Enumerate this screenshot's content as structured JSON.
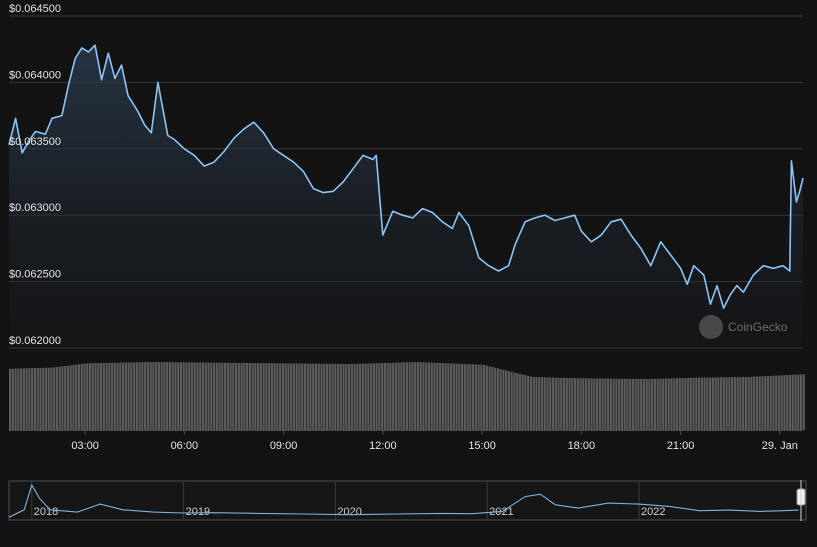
{
  "chart_data": {
    "type": "area",
    "y_axis": {
      "ticks": [
        0.062,
        0.0625,
        0.063,
        0.0635,
        0.064,
        0.0645
      ],
      "tick_labels": [
        "$0.062000",
        "$0.062500",
        "$0.063000",
        "$0.063500",
        "$0.064000",
        "$0.064500"
      ],
      "ylim": [
        0.062,
        0.0645
      ]
    },
    "x_axis": {
      "tick_labels": [
        "03:00",
        "06:00",
        "09:00",
        "12:00",
        "15:00",
        "18:00",
        "21:00",
        "29. Jan"
      ],
      "tick_hours": [
        3,
        6,
        9,
        12,
        15,
        18,
        21,
        24
      ],
      "range_hours": [
        0.7,
        24.7
      ]
    },
    "series": [
      {
        "values": [
          [
            0.7,
            0.06353
          ],
          [
            0.9,
            0.06373
          ],
          [
            1.1,
            0.06347
          ],
          [
            1.3,
            0.06356
          ],
          [
            1.5,
            0.06363
          ],
          [
            1.8,
            0.06361
          ],
          [
            2.0,
            0.06373
          ],
          [
            2.3,
            0.06375
          ],
          [
            2.5,
            0.06398
          ],
          [
            2.7,
            0.06418
          ],
          [
            2.9,
            0.06426
          ],
          [
            3.1,
            0.06423
          ],
          [
            3.3,
            0.06428
          ],
          [
            3.5,
            0.06402
          ],
          [
            3.7,
            0.06422
          ],
          [
            3.9,
            0.06403
          ],
          [
            4.1,
            0.06413
          ],
          [
            4.3,
            0.0639
          ],
          [
            4.6,
            0.06378
          ],
          [
            4.8,
            0.06368
          ],
          [
            5.0,
            0.06362
          ],
          [
            5.2,
            0.064
          ],
          [
            5.5,
            0.0636
          ],
          [
            5.7,
            0.06357
          ],
          [
            6.0,
            0.0635
          ],
          [
            6.3,
            0.06345
          ],
          [
            6.6,
            0.06337
          ],
          [
            6.9,
            0.0634
          ],
          [
            7.2,
            0.06348
          ],
          [
            7.5,
            0.06358
          ],
          [
            7.8,
            0.06365
          ],
          [
            8.1,
            0.0637
          ],
          [
            8.4,
            0.06362
          ],
          [
            8.7,
            0.0635
          ],
          [
            9.0,
            0.06345
          ],
          [
            9.3,
            0.0634
          ],
          [
            9.6,
            0.06333
          ],
          [
            9.9,
            0.0632
          ],
          [
            10.2,
            0.06317
          ],
          [
            10.5,
            0.06318
          ],
          [
            10.8,
            0.06325
          ],
          [
            11.1,
            0.06335
          ],
          [
            11.4,
            0.06345
          ],
          [
            11.7,
            0.06342
          ],
          [
            11.8,
            0.06345
          ],
          [
            12.0,
            0.06285
          ],
          [
            12.3,
            0.06303
          ],
          [
            12.6,
            0.063
          ],
          [
            12.9,
            0.06298
          ],
          [
            13.2,
            0.06305
          ],
          [
            13.5,
            0.06302
          ],
          [
            13.8,
            0.06295
          ],
          [
            14.1,
            0.0629
          ],
          [
            14.3,
            0.06302
          ],
          [
            14.6,
            0.06292
          ],
          [
            14.9,
            0.06268
          ],
          [
            15.2,
            0.06262
          ],
          [
            15.5,
            0.06258
          ],
          [
            15.8,
            0.06262
          ],
          [
            16.0,
            0.06278
          ],
          [
            16.3,
            0.06295
          ],
          [
            16.6,
            0.06298
          ],
          [
            16.9,
            0.063
          ],
          [
            17.2,
            0.06296
          ],
          [
            17.5,
            0.06298
          ],
          [
            17.8,
            0.063
          ],
          [
            18.0,
            0.06288
          ],
          [
            18.3,
            0.0628
          ],
          [
            18.6,
            0.06285
          ],
          [
            18.9,
            0.06295
          ],
          [
            19.2,
            0.06297
          ],
          [
            19.5,
            0.06285
          ],
          [
            19.8,
            0.06275
          ],
          [
            20.1,
            0.06262
          ],
          [
            20.4,
            0.0628
          ],
          [
            20.7,
            0.0627
          ],
          [
            21.0,
            0.0626
          ],
          [
            21.2,
            0.06248
          ],
          [
            21.4,
            0.06262
          ],
          [
            21.7,
            0.06255
          ],
          [
            21.9,
            0.06233
          ],
          [
            22.1,
            0.06247
          ],
          [
            22.3,
            0.0623
          ],
          [
            22.5,
            0.0624
          ],
          [
            22.7,
            0.06247
          ],
          [
            22.9,
            0.06242
          ],
          [
            23.2,
            0.06255
          ],
          [
            23.5,
            0.06262
          ],
          [
            23.8,
            0.0626
          ],
          [
            24.1,
            0.06262
          ],
          [
            24.3,
            0.06258
          ],
          [
            24.35,
            0.06341
          ],
          [
            24.5,
            0.0631
          ],
          [
            24.6,
            0.06318
          ],
          [
            24.7,
            0.06328
          ]
        ]
      }
    ],
    "volume": {
      "description_free": true,
      "values": [
        [
          0.7,
          0.9
        ],
        [
          2.0,
          0.92
        ],
        [
          3.0,
          0.98
        ],
        [
          5.0,
          1.0
        ],
        [
          9.0,
          0.98
        ],
        [
          11.0,
          0.97
        ],
        [
          13.0,
          1.0
        ],
        [
          15.0,
          0.96
        ],
        [
          16.5,
          0.78
        ],
        [
          18.0,
          0.76
        ],
        [
          20.0,
          0.75
        ],
        [
          21.5,
          0.77
        ],
        [
          23.0,
          0.78
        ],
        [
          24.7,
          0.82
        ]
      ]
    },
    "navigator": {
      "tick_labels": [
        "2018",
        "2019",
        "2020",
        "2021",
        "2022"
      ],
      "tick_years": [
        2018,
        2019,
        2020,
        2021,
        2022
      ],
      "range_years": [
        2017.85,
        2023.1
      ],
      "values": [
        [
          2017.85,
          0.02
        ],
        [
          2017.95,
          0.25
        ],
        [
          2018.0,
          1.0
        ],
        [
          2018.05,
          0.6
        ],
        [
          2018.12,
          0.25
        ],
        [
          2018.3,
          0.18
        ],
        [
          2018.45,
          0.42
        ],
        [
          2018.6,
          0.25
        ],
        [
          2018.8,
          0.18
        ],
        [
          2019.0,
          0.15
        ],
        [
          2019.2,
          0.16
        ],
        [
          2019.5,
          0.14
        ],
        [
          2019.8,
          0.12
        ],
        [
          2020.1,
          0.1
        ],
        [
          2020.4,
          0.12
        ],
        [
          2020.7,
          0.14
        ],
        [
          2020.9,
          0.13
        ],
        [
          2021.1,
          0.2
        ],
        [
          2021.25,
          0.65
        ],
        [
          2021.35,
          0.72
        ],
        [
          2021.45,
          0.4
        ],
        [
          2021.6,
          0.3
        ],
        [
          2021.8,
          0.45
        ],
        [
          2022.0,
          0.42
        ],
        [
          2022.2,
          0.35
        ],
        [
          2022.4,
          0.22
        ],
        [
          2022.6,
          0.24
        ],
        [
          2022.8,
          0.2
        ],
        [
          2022.95,
          0.22
        ],
        [
          2023.05,
          0.24
        ]
      ]
    }
  },
  "watermark": {
    "text": "CoinGecko"
  },
  "colors": {
    "line": "#8cc4f7",
    "grid": "#3a3a3a",
    "text": "#e6e6e6",
    "volume": "#5c5c5c",
    "background": "#131313"
  }
}
